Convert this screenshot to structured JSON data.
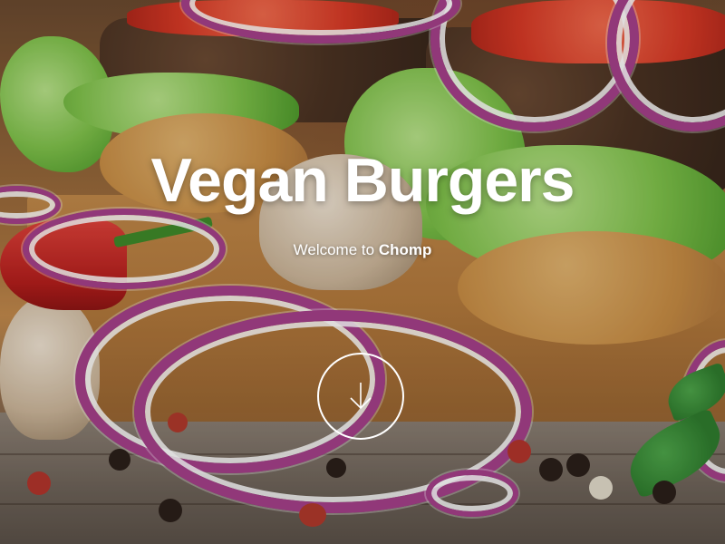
{
  "hero": {
    "title": "Vegan Burgers",
    "subtitle_prefix": "Welcome to",
    "brand": "Chomp",
    "scroll_icon": "arrow-down-icon"
  },
  "colors": {
    "text": "#ffffff",
    "onion": "#a5408a",
    "lettuce": "#7fc24a",
    "tomato": "#d93a26"
  }
}
